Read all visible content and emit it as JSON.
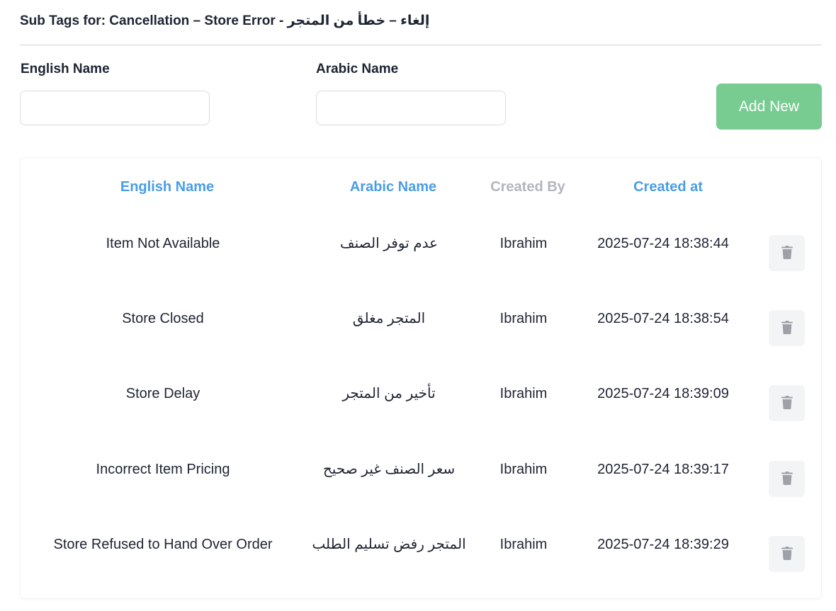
{
  "header": {
    "title": "Sub Tags for: Cancellation – Store Error - إلغاء – خطأ من المتجر"
  },
  "form": {
    "english_label": "English Name",
    "english_value": "",
    "arabic_label": "Arabic Name",
    "arabic_value": "",
    "add_button_label": "Add New"
  },
  "table": {
    "columns": [
      "English Name",
      "Arabic Name",
      "Created By",
      "Created at"
    ],
    "rows": [
      {
        "english": "Item Not Available",
        "arabic": "عدم توفر الصنف",
        "created_by": "Ibrahim",
        "created_at": "2025-07-24 18:38:44"
      },
      {
        "english": "Store Closed",
        "arabic": "المتجر مغلق",
        "created_by": "Ibrahim",
        "created_at": "2025-07-24 18:38:54"
      },
      {
        "english": "Store Delay",
        "arabic": "تأخير من المتجر",
        "created_by": "Ibrahim",
        "created_at": "2025-07-24 18:39:09"
      },
      {
        "english": "Incorrect Item Pricing",
        "arabic": "سعر الصنف غير صحيح",
        "created_by": "Ibrahim",
        "created_at": "2025-07-24 18:39:17"
      },
      {
        "english": "Store Refused to Hand Over Order",
        "arabic": "المتجر رفض تسليم الطلب",
        "created_by": "Ibrahim",
        "created_at": "2025-07-24 18:39:29"
      }
    ]
  },
  "icons": {
    "delete": "trash-icon"
  },
  "colors": {
    "accent_blue": "#4a9de6",
    "add_button_green": "#78cc91",
    "muted_header": "#b3b6bd",
    "text_dark": "#1f2433",
    "trash_icon": "#9ea1a8"
  }
}
